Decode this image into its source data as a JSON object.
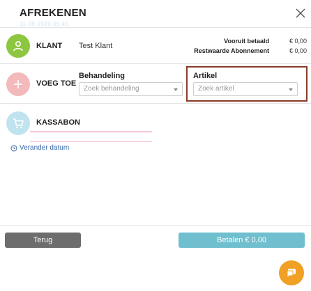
{
  "header": {
    "title": "AFREKENEN",
    "ghost_text": "11-09-2020 09:45",
    "close_icon": "close-icon"
  },
  "klant": {
    "label": "KLANT",
    "name": "Test Klant",
    "icon": "user-icon",
    "accent": "#8dc63f",
    "vooruit_label": "Vooruit betaald",
    "vooruit_value": "€ 0,00",
    "restwaarde_label": "Restwaarde Abonnement",
    "restwaarde_value": "€ 0,00"
  },
  "voeg_toe": {
    "label": "VOEG TOE",
    "icon": "plus-icon",
    "accent": "#f3b9bb",
    "behandeling_label": "Behandeling",
    "behandeling_placeholder": "Zoek behandeling",
    "artikel_label": "Artikel",
    "artikel_placeholder": "Zoek artikel"
  },
  "kassabon": {
    "label": "KASSABON",
    "icon": "cart-icon",
    "accent": "#bfe3ef"
  },
  "datum_link": "Verander datum",
  "footer": {
    "terug_label": "Terug",
    "betalen_label": "Betalen € 0,00",
    "terug_color": "#6d6d6d",
    "betalen_color": "#6fbfcf"
  },
  "chat": {
    "icon": "chat-icon",
    "color": "#f0a024"
  }
}
